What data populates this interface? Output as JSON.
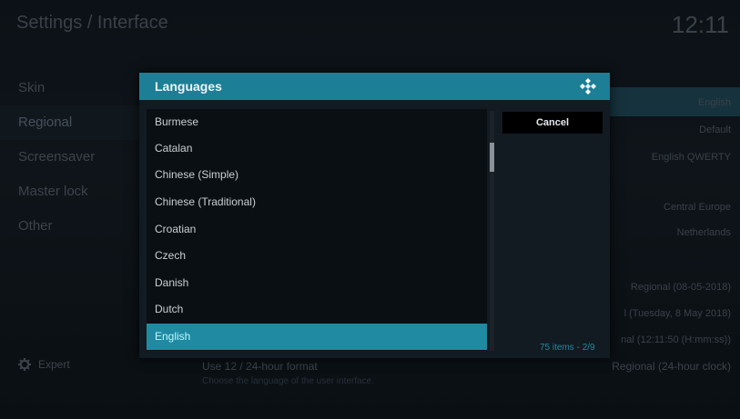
{
  "background": {
    "title": "Settings / Interface",
    "clock": "12:11",
    "nav": [
      {
        "label": "Skin",
        "active": false
      },
      {
        "label": "Regional",
        "active": true
      },
      {
        "label": "Screensaver",
        "active": false
      },
      {
        "label": "Master lock",
        "active": false
      },
      {
        "label": "Other",
        "active": false
      }
    ],
    "expert_label": "Expert",
    "values": {
      "language": "English",
      "char_set": "Default",
      "keyboard": "English QWERTY",
      "timezone_country": "Central Europe",
      "timezone": "Netherlands",
      "short_date": "Regional (08-05-2018)",
      "long_date": "l (Tuesday, 8 May 2018)",
      "time_format": "nal (12:11:50 (H:mm:ss))",
      "clock_24h": "Regional (24-hour clock)"
    },
    "footer_row": "Use 12 / 24-hour format",
    "footer_sub": "Choose the language of the user interface."
  },
  "dialog": {
    "title": "Languages",
    "items": [
      "Burmese",
      "Catalan",
      "Chinese (Simple)",
      "Chinese (Traditional)",
      "Croatian",
      "Czech",
      "Danish",
      "Dutch",
      "English"
    ],
    "selected_item": "English",
    "cancel_label": "Cancel",
    "count_label": "75 items - ",
    "page_label": "2/9",
    "scroll_position": 0.15
  },
  "colors": {
    "accent": "#1f8aa1",
    "header": "#1c7f96"
  }
}
